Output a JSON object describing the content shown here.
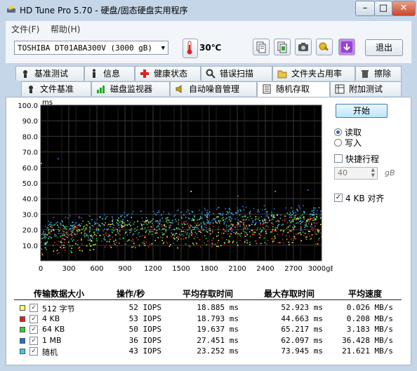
{
  "window": {
    "title": "HD Tune Pro 5.70 - 硬盘/固态硬盘实用程序",
    "min_label": "–",
    "max_label": "□",
    "close_label": "✕"
  },
  "menu": [
    {
      "label": "文件(F)"
    },
    {
      "label": "帮助(H)"
    }
  ],
  "toolbar": {
    "drive": "TOSHIBA DT01ABA300V (3000 gB)",
    "temperature": "30℃",
    "exit_label": "退出",
    "icons": [
      "copy-info-icon",
      "copy-screen-icon",
      "camera-icon",
      "options-icon",
      "save-icon"
    ]
  },
  "tabs_row1": [
    {
      "label": "基准测试",
      "icon": "benchmark-icon"
    },
    {
      "label": "信息",
      "icon": "info-icon"
    },
    {
      "label": "健康状态",
      "icon": "health-icon"
    },
    {
      "label": "错误扫描",
      "icon": "error-scan-icon"
    },
    {
      "label": "文件夹占用率",
      "icon": "folder-icon"
    },
    {
      "label": "擦除",
      "icon": "erase-icon"
    }
  ],
  "tabs_row2": [
    {
      "label": "文件基准",
      "icon": "file-benchmark-icon"
    },
    {
      "label": "磁盘监视器",
      "icon": "disk-monitor-icon"
    },
    {
      "label": "自动噪音管理",
      "icon": "speaker-icon"
    },
    {
      "label": "随机存取",
      "icon": "random-access-icon",
      "active": true
    },
    {
      "label": "附加测试",
      "icon": "extra-tests-icon"
    }
  ],
  "controls": {
    "start_label": "开始",
    "read_label": "读取",
    "write_label": "写入",
    "mode_selected": "读取",
    "short_stroke_label": "快捷行程",
    "short_stroke_checked": false,
    "short_stroke_value": "40",
    "short_stroke_unit": "gB",
    "align_label": "4 KB 对齐",
    "align_checked": true
  },
  "chart_data": {
    "type": "scatter",
    "title": "",
    "xlabel": "",
    "ylabel": "ms",
    "xlim": [
      0,
      3000
    ],
    "ylim": [
      0,
      100
    ],
    "x_ticks": [
      "0",
      "300",
      "600",
      "900",
      "1200",
      "1500",
      "1800",
      "2100",
      "2400",
      "2700",
      "3000gB"
    ],
    "y_ticks": [
      "10.0",
      "20.0",
      "30.0",
      "40.0",
      "50.0",
      "60.0",
      "70.0",
      "80.0",
      "90.0",
      "100.0"
    ],
    "grid": true,
    "series": [
      {
        "name": "512 字节",
        "color": "#f2f266",
        "min_ms": [
          3,
          11
        ],
        "max_ms": [
          22,
          31
        ]
      },
      {
        "name": "4 KB",
        "color": "#e02828",
        "min_ms": [
          3,
          11
        ],
        "max_ms": [
          20,
          28
        ]
      },
      {
        "name": "64 KB",
        "color": "#3fcf3a",
        "min_ms": [
          4,
          12
        ],
        "max_ms": [
          22,
          31
        ]
      },
      {
        "name": "1 MB",
        "color": "#2a7ad8",
        "min_ms": [
          10,
          22
        ],
        "max_ms": [
          26,
          37
        ]
      },
      {
        "name": "随机",
        "color": "#42c8e8",
        "min_ms": [
          8,
          20
        ],
        "max_ms": [
          24,
          35
        ]
      }
    ]
  },
  "table": {
    "headers": [
      "传输数据大小",
      "操作/秒",
      "平均存取时间",
      "最大存取时间",
      "平均速度"
    ],
    "rows": [
      {
        "name": "512 字节",
        "color": "#ffff66",
        "checked": "✓",
        "ops": "52 IOPS",
        "avg": "18.885 ms",
        "max": "52.923 ms",
        "speed": "0.026 MB/s"
      },
      {
        "name": "4 KB",
        "color": "#e02020",
        "checked": "✓",
        "ops": "53 IOPS",
        "avg": "18.793 ms",
        "max": "44.663 ms",
        "speed": "0.208 MB/s"
      },
      {
        "name": "64 KB",
        "color": "#33cc33",
        "checked": "✓",
        "ops": "50 IOPS",
        "avg": "19.637 ms",
        "max": "65.217 ms",
        "speed": "3.183 MB/s"
      },
      {
        "name": "1 MB",
        "color": "#1f6fd8",
        "checked": "✓",
        "ops": "36 IOPS",
        "avg": "27.451 ms",
        "max": "62.097 ms",
        "speed": "36.428 MB/s"
      },
      {
        "name": "随机",
        "color": "#33ccee",
        "checked": "✓",
        "ops": "43 IOPS",
        "avg": "23.252 ms",
        "max": "73.945 ms",
        "speed": "21.621 MB/s"
      }
    ]
  }
}
